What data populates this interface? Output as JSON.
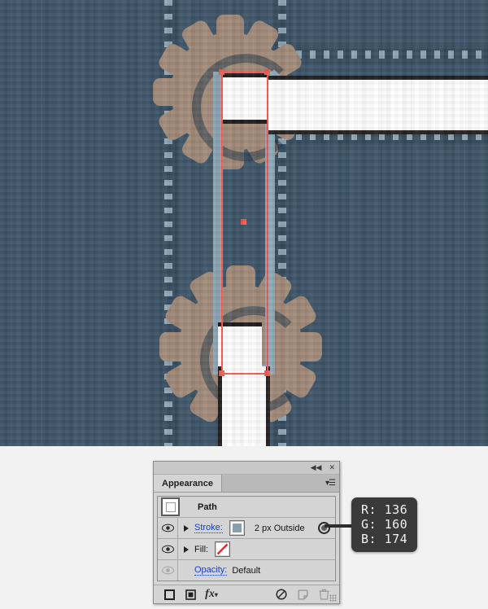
{
  "app": {
    "canvas_bg_color": "#3d5568",
    "gear_color": "#a18a79",
    "stroke_color": "#88a0ae",
    "selection_color": "#f1584f"
  },
  "panel": {
    "title": "Appearance",
    "topbar": {
      "collapse_icon": "◀◀",
      "close_icon": "✕"
    },
    "menu_icon": "▾☰",
    "rows": [
      {
        "id": "path",
        "label": "Path",
        "thumb_icon": "path-thumbnail-icon"
      },
      {
        "id": "stroke",
        "label": "Stroke:",
        "eye_icon": "eye-icon",
        "disclosure_icon": "triangle-right-icon",
        "swatch_color": "#88a0ae",
        "meta": "2 px  Outside",
        "connector_icon": "connector-dot-icon"
      },
      {
        "id": "fill",
        "label": "Fill:",
        "eye_icon": "eye-icon",
        "disclosure_icon": "triangle-right-icon",
        "swatch_color": "none"
      },
      {
        "id": "opacity",
        "label": "Opacity:",
        "value": "Default",
        "eye_icon": "eye-icon-disabled"
      }
    ],
    "footer_icons": [
      "new-stroke-icon",
      "new-fill-icon",
      "fx-icon",
      "clear-appearance-icon",
      "duplicate-item-icon",
      "delete-item-icon"
    ],
    "fx_label": "fx"
  },
  "callout": {
    "r_label": "R:",
    "r_value": "136",
    "g_label": "G:",
    "g_value": "160",
    "b_label": "B:",
    "b_value": "174",
    "line_r": "R: 136",
    "line_g": "G: 160",
    "line_b": "B: 174"
  }
}
